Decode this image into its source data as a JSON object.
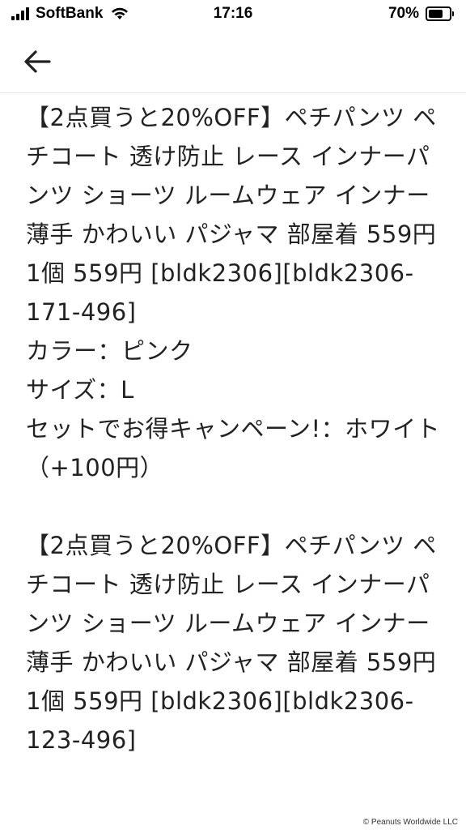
{
  "status_bar": {
    "carrier": "SoftBank",
    "time": "17:16",
    "battery_percent_text": "70%",
    "battery_level": 0.7
  },
  "order": {
    "separator": "---------",
    "items": [
      {
        "title": "【2点買うと20%OFF】ペチパンツ ペチコート 透け防止 レース インナーパンツ ショーツ ルームウェア インナー 薄手 かわいい パジャマ 部屋着 559円 1個 559円 [bldk2306][bldk2306-171-496]",
        "color": "カラー：ピンク",
        "size": "サイズ：L",
        "option": "セットでお得キャンペーン!：ホワイト（+100円）"
      },
      {
        "title": "【2点買うと20%OFF】ペチパンツ ペチコート 透け防止 レース インナーパンツ ショーツ ルームウェア インナー 薄手 かわいい パジャマ 部屋着 559円 1個 559円 [bldk2306][bldk2306-123-496]"
      }
    ]
  },
  "footer": {
    "copyright": "© Peanuts Worldwide LLC"
  }
}
